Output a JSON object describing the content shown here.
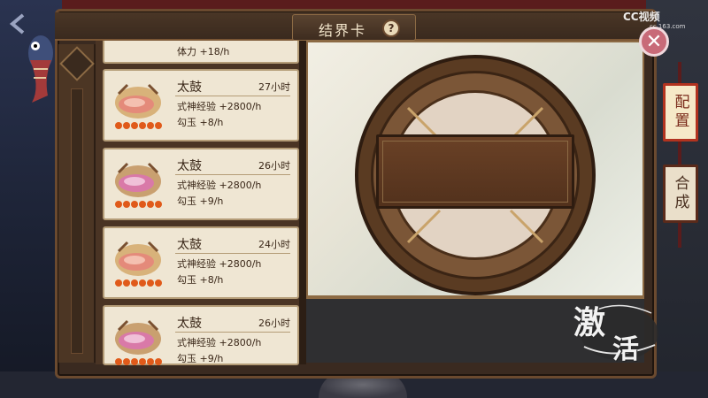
{
  "header": {
    "title": "结界卡",
    "help_icon": "?"
  },
  "watermark": {
    "brand": "CC视频",
    "sub": "cc.163.com"
  },
  "close_button": "✕",
  "list": {
    "partial_top_text": "体力 +18/h",
    "cards": [
      {
        "name": "太鼓",
        "time": "27小时",
        "exp": "式神经验 +2800/h",
        "jade": "勾玉 +8/h"
      },
      {
        "name": "太鼓",
        "time": "26小时",
        "exp": "式神经验 +2800/h",
        "jade": "勾玉 +9/h"
      },
      {
        "name": "太鼓",
        "time": "24小时",
        "exp": "式神经验 +2800/h",
        "jade": "勾玉 +8/h"
      },
      {
        "name": "太鼓",
        "time": "26小时",
        "exp": "式神经验 +2800/h",
        "jade": "勾玉 +9/h"
      }
    ]
  },
  "side_tabs": {
    "configure": "配置",
    "synthesize": "合成"
  },
  "activate_button": {
    "char1": "激",
    "char2": "活"
  },
  "colors": {
    "frame": "#3a2a20",
    "card": "#efe6d3",
    "accent_red": "#b2331f"
  }
}
